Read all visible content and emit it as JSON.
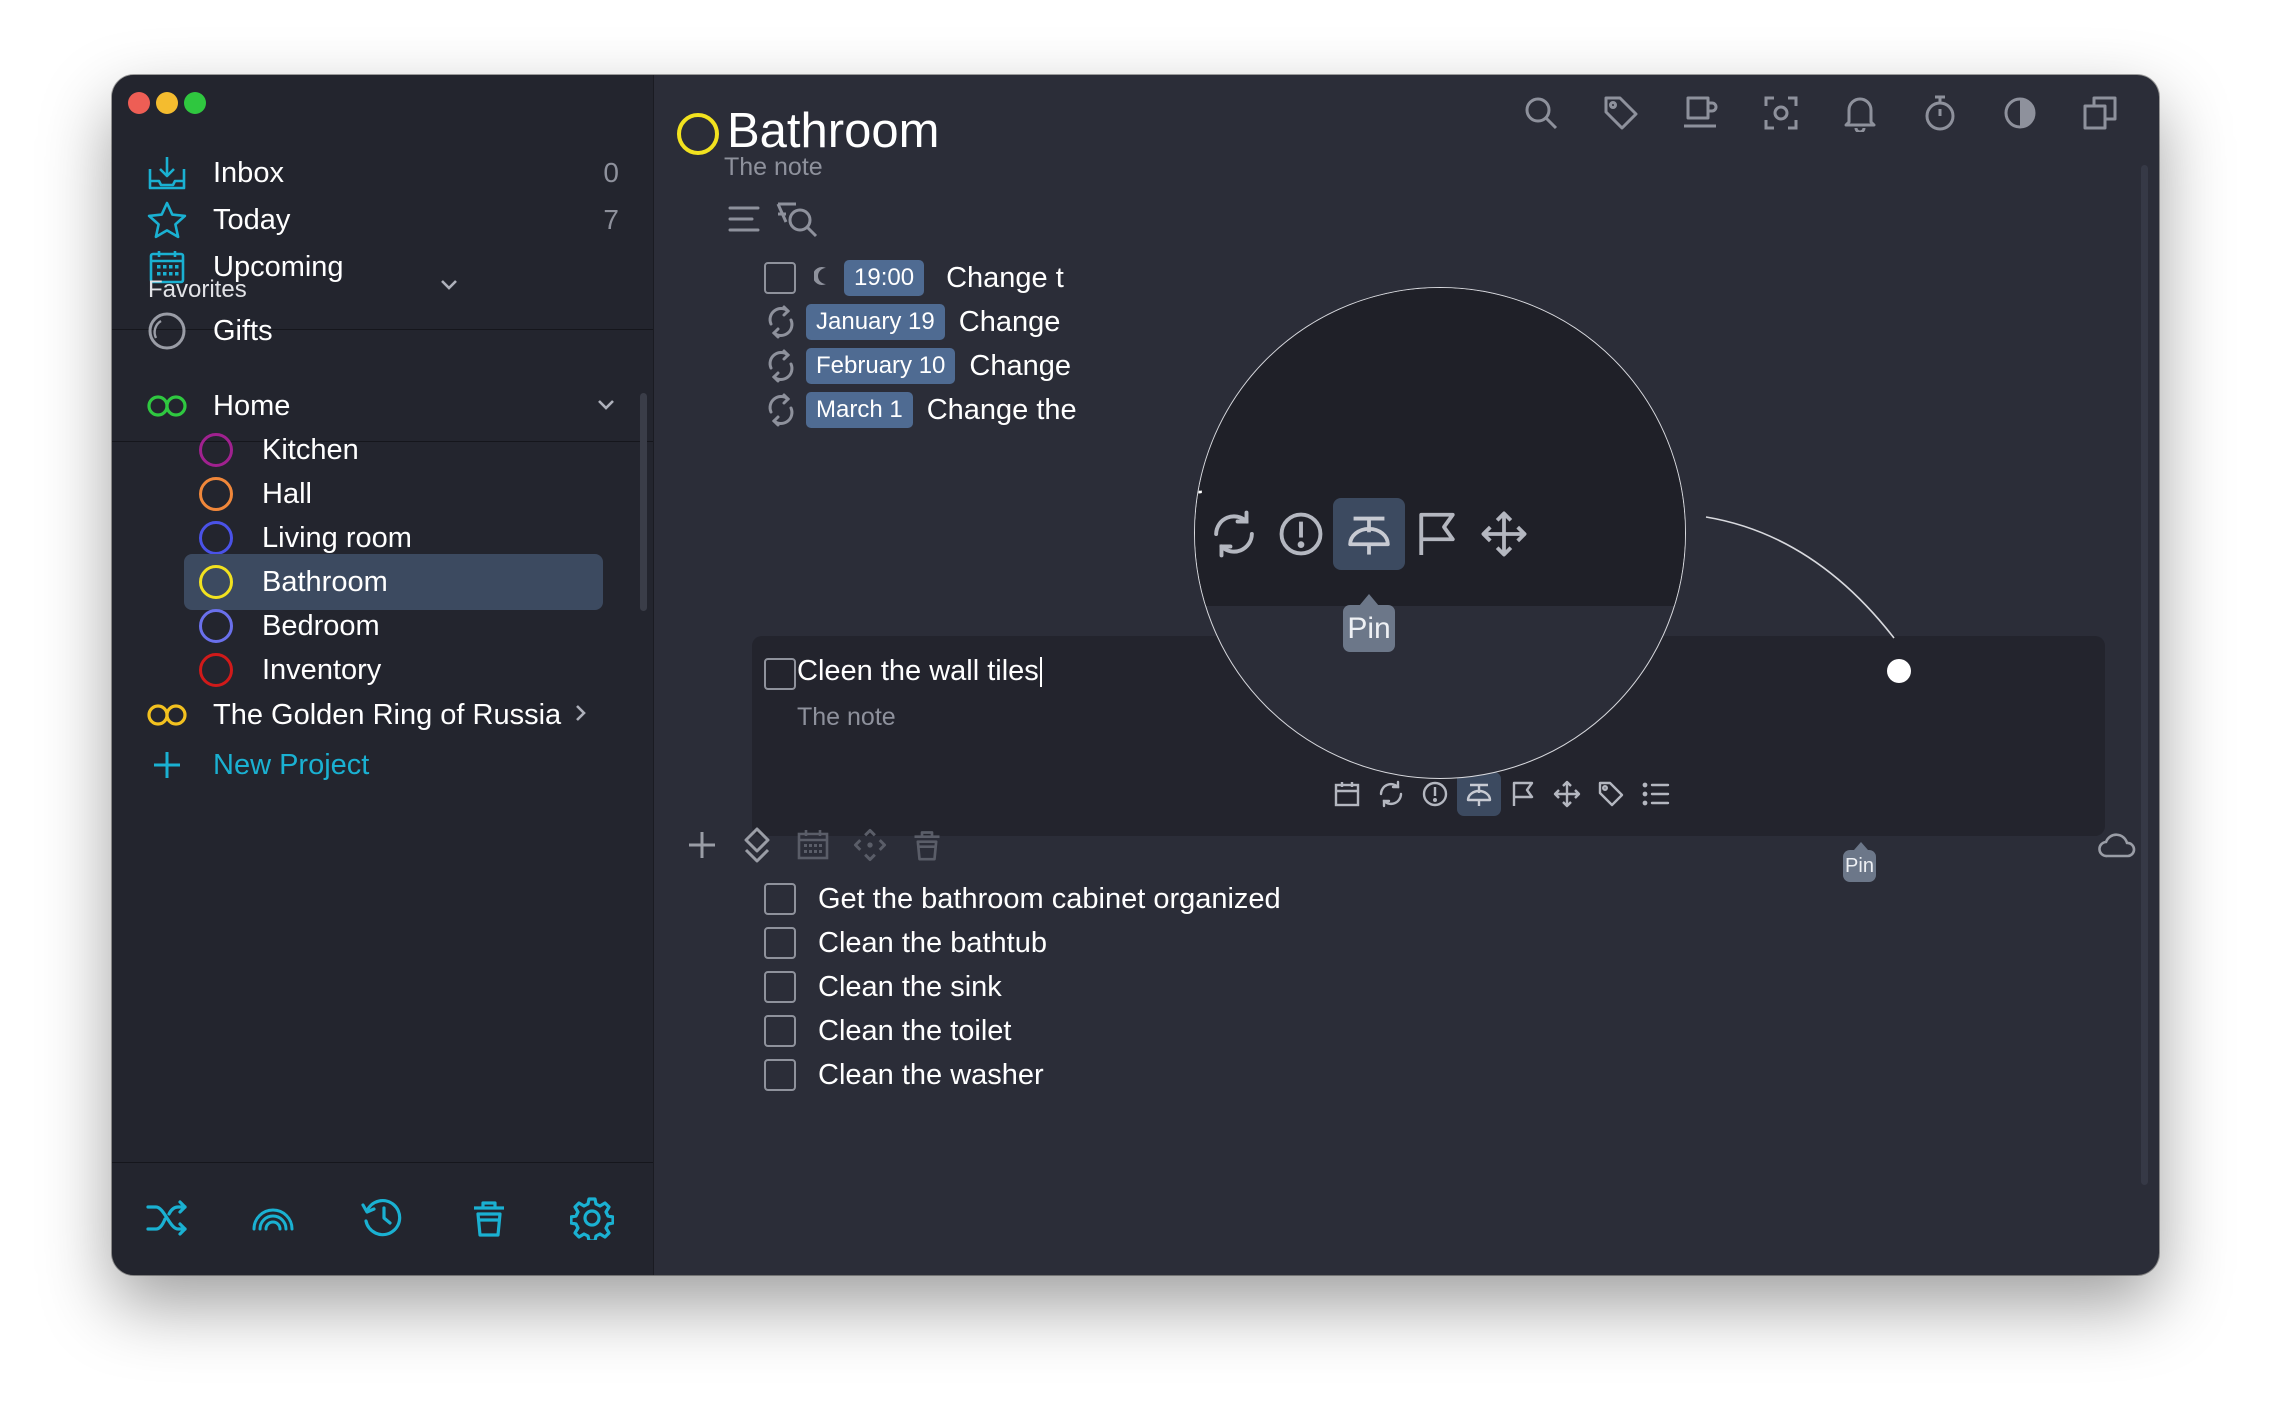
{
  "sidebar": {
    "nav": [
      {
        "label": "Inbox",
        "count": "0"
      },
      {
        "label": "Today",
        "count": "7"
      },
      {
        "label": "Upcoming",
        "count": ""
      }
    ],
    "favorites": {
      "title": "Favorites",
      "items": [
        {
          "label": "Gifts"
        }
      ]
    },
    "projects": {
      "home": {
        "label": "Home",
        "children": [
          {
            "label": "Kitchen",
            "color": "#a0218f"
          },
          {
            "label": "Hall",
            "color": "#f0873a"
          },
          {
            "label": "Living room",
            "color": "#4a52e8"
          },
          {
            "label": "Bathroom",
            "color": "#f2e21f"
          },
          {
            "label": "Bedroom",
            "color": "#6a70ec"
          },
          {
            "label": "Inventory",
            "color": "#d01a1a"
          }
        ]
      },
      "golden_ring": {
        "label": "The Golden Ring of Russia"
      },
      "new_project": "New Project"
    },
    "bottom_icons": [
      "shuffle-icon",
      "rainbow-icon",
      "history-icon",
      "trash-icon",
      "settings-icon"
    ]
  },
  "toolbar": {
    "icons": [
      "search-icon",
      "tag-icon",
      "coffee-icon",
      "focus-icon",
      "bell-icon",
      "stopwatch-icon",
      "contrast-icon",
      "windows-icon"
    ]
  },
  "project": {
    "title": "Bathroom",
    "note": "The note",
    "color": "#f2e21f"
  },
  "tasks": [
    {
      "time": "19:00",
      "text": "Change t",
      "has_checkbox": true
    },
    {
      "date": "January 19",
      "text": "Change",
      "repeat": true
    },
    {
      "date": "February 10",
      "text": "Change",
      "repeat": true
    },
    {
      "date": "March 1",
      "text": "Change the",
      "repeat": true
    }
  ],
  "editing_task": {
    "text": "Cleen the wall tiles",
    "note": "The note",
    "tools": [
      "calendar-icon",
      "repeat-icon",
      "priority-icon",
      "pin-icon",
      "flag-icon",
      "move-icon",
      "tag-icon",
      "checklist-icon"
    ],
    "tooltip": "Pin"
  },
  "other_tasks": [
    {
      "text": "Get the bathroom cabinet organized"
    },
    {
      "text": "Clean the bathtub"
    },
    {
      "text": "Clean the sink"
    },
    {
      "text": "Clean the toilet"
    },
    {
      "text": "Clean the washer"
    }
  ],
  "magnifier": {
    "tooltip": "Pin",
    "tools": [
      "repeat-icon",
      "priority-icon",
      "pin-icon",
      "flag-icon",
      "move-icon"
    ]
  },
  "bottom_toolbar": [
    "add-icon",
    "diamond-icon",
    "calendar-icon",
    "move-icon",
    "trash-icon"
  ],
  "colors": {
    "accent": "#1ab1d2",
    "window_bg": "#2b2d38",
    "sidebar_bg": "#23252e",
    "active_row": "#3c4a60",
    "date_badge": "#4f6b92"
  }
}
